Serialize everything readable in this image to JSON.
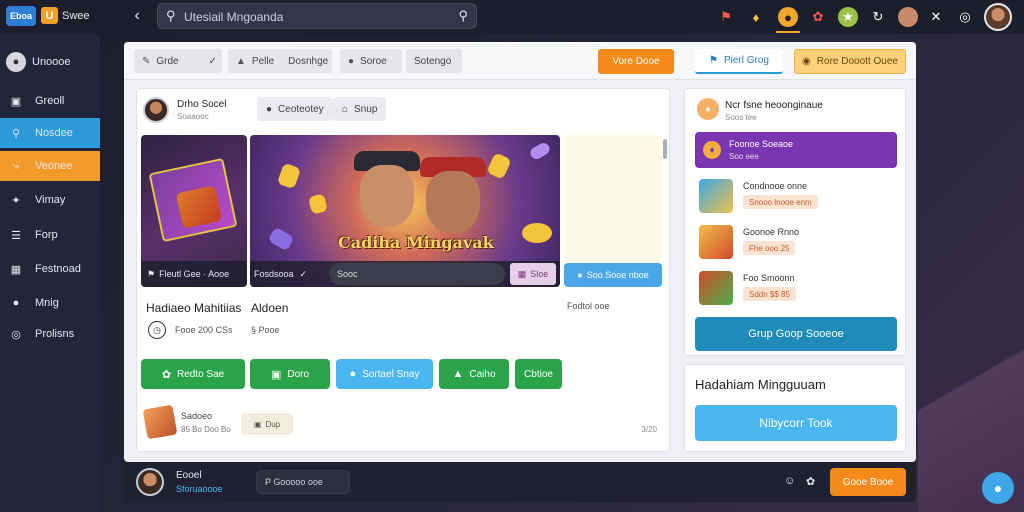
{
  "app": {
    "logo_a": "Eboa",
    "logo_b": "U",
    "logo_text": "Swee"
  },
  "search": {
    "text": "Utesiail Mngoanda"
  },
  "sidebar": {
    "user_label": "Unoooe",
    "items": [
      {
        "label": "Greoll",
        "icon": "home-icon"
      },
      {
        "label": "Nosdee",
        "icon": "key-icon"
      },
      {
        "label": "Veonee",
        "icon": "bolt-icon"
      },
      {
        "label": "Vimay",
        "icon": "puzzle-icon"
      },
      {
        "label": "Forp",
        "icon": "menu-icon"
      },
      {
        "label": "Festnoad",
        "icon": "bookmark-icon"
      },
      {
        "label": "Mnig",
        "icon": "chat-icon"
      },
      {
        "label": "Prolisns",
        "icon": "settings-icon"
      }
    ]
  },
  "tabs": {
    "chip1": "Grde",
    "chip2a": "Pelle",
    "chip2b": "Dosnhge",
    "chip3": "Soroe",
    "chip4": "Sotengo",
    "orange": "Vore Dooe",
    "blue": "Pierl Grog",
    "yellow": "Rore Dooott Ouee"
  },
  "post": {
    "name": "Drho Socel",
    "sub": "Soaaooc",
    "pill1": "Ceoteotey",
    "pill2": "Snup",
    "small_caption": "Fleutl Gee · Aooe",
    "big_title": "Cadiha Mingavak",
    "bar1": "Fosdsooa",
    "bar2": "Sooc",
    "bar3": "Sloe",
    "blue_chip": "Soo Sooe nboe",
    "cap_title1": "Hadiaeo Mahitiias",
    "cap_title2": "Aldoen",
    "cap_sub1": "Fooe 200 CSs",
    "cap_sub2": "§ Pooe",
    "side_note": "Fodtol ooe"
  },
  "actions": [
    "Redto Sae",
    "Doro",
    "Sortael Snay",
    "Caiho",
    "Cbtioe"
  ],
  "gift": {
    "label": "Sadoeo",
    "sub": "85 Bo Doo Bo",
    "chip": "Dup",
    "corner": "3/20"
  },
  "right": {
    "title": "Ncr fsne heoonginaue",
    "sub": "Soos tee",
    "purple_title": "Foonoe Soeaoe",
    "purple_sub": "Soo eee",
    "items": [
      {
        "name": "Condnooe onne",
        "tag": "Snooo lnooe enm"
      },
      {
        "name": "Goonoe Rnno",
        "tag": "Fhe ooo 25"
      },
      {
        "name": "Foo Smoonn",
        "tag": "Sddn $$ 85"
      }
    ],
    "cta": "Grup Goop Sooeoe"
  },
  "right2": {
    "title": "Hadahiam Mingguuam",
    "button": "Nibycorr Took"
  },
  "bottom": {
    "name": "Eooel",
    "sub": "Sforuaoooe",
    "input": "P Gooooo ooe",
    "button": "Gooe Booe"
  }
}
